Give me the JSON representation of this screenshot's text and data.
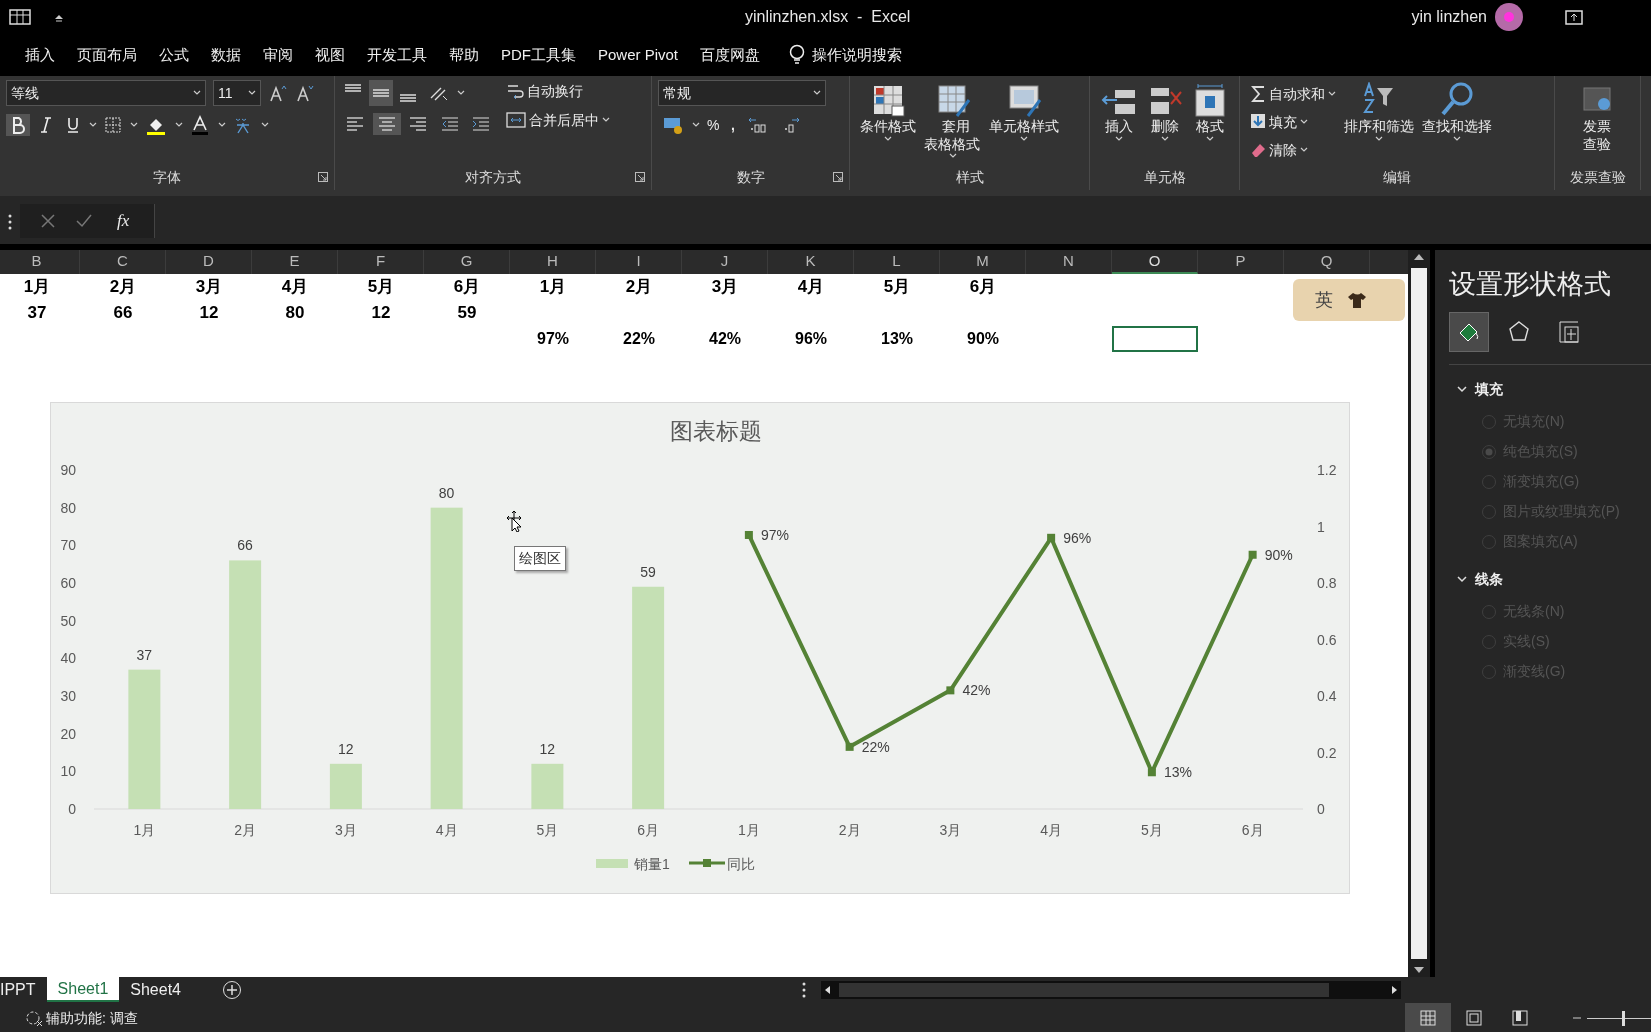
{
  "window": {
    "title": "yinlinzhen.xlsx  -  Excel",
    "user": "yin linzhen"
  },
  "menu_tabs": [
    "插入",
    "页面布局",
    "公式",
    "数据",
    "审阅",
    "视图",
    "开发工具",
    "帮助",
    "PDF工具集",
    "Power Pivot",
    "百度网盘"
  ],
  "tell_me": "操作说明搜索",
  "ribbon": {
    "font": {
      "group": "字体",
      "font_name": "等线",
      "font_size": "11",
      "bold": true,
      "italic": false,
      "underline": false
    },
    "alignment": {
      "group": "对齐方式",
      "vertical": [
        {
          "selected": false
        },
        {
          "selected": true
        },
        {
          "selected": false
        }
      ],
      "horizontal": [
        {
          "selected": false
        },
        {
          "selected": true
        },
        {
          "selected": false
        }
      ],
      "wrap": "自动换行",
      "merge": "合并后居中"
    },
    "number": {
      "group": "数字",
      "format": "常规",
      "percent": "%",
      "comma": ","
    },
    "styles": {
      "group": "样式",
      "buttons": [
        {
          "label": "条件格式",
          "kind": "conditional"
        },
        {
          "label": "套用表格格式",
          "kind": "table"
        },
        {
          "label": "单元格样式",
          "kind": "cellstyle"
        }
      ]
    },
    "cells": {
      "group": "单元格",
      "buttons": [
        {
          "label": "插入",
          "kind": "insert"
        },
        {
          "label": "删除",
          "kind": "delete"
        },
        {
          "label": "格式",
          "kind": "format"
        }
      ]
    },
    "editing": {
      "group": "编辑",
      "small": [
        {
          "label": "自动求和",
          "kind": "sum"
        },
        {
          "label": "填充",
          "kind": "fill"
        },
        {
          "label": "清除",
          "kind": "clear"
        }
      ],
      "buttons": [
        {
          "label": "排序和筛选",
          "kind": "sort"
        },
        {
          "label": "查找和选择",
          "kind": "find"
        }
      ]
    },
    "invoice": {
      "group": "发票查验",
      "button": "发票查验"
    }
  },
  "formula_bar": {
    "fx": "fx"
  },
  "columns": [
    {
      "label": "B",
      "selected": false
    },
    {
      "label": "C",
      "selected": false
    },
    {
      "label": "D",
      "selected": false
    },
    {
      "label": "E",
      "selected": false
    },
    {
      "label": "F",
      "selected": false
    },
    {
      "label": "G",
      "selected": false
    },
    {
      "label": "H",
      "selected": false
    },
    {
      "label": "I",
      "selected": false
    },
    {
      "label": "J",
      "selected": false
    },
    {
      "label": "K",
      "selected": false
    },
    {
      "label": "L",
      "selected": false
    },
    {
      "label": "M",
      "selected": false
    },
    {
      "label": "N",
      "selected": false
    },
    {
      "label": "O",
      "selected": true
    },
    {
      "label": "P",
      "selected": false
    },
    {
      "label": "Q",
      "selected": false
    }
  ],
  "rows": [
    {
      "selected": false,
      "cells": [
        "1月",
        "2月",
        "3月",
        "4月",
        "5月",
        "6月",
        "1月",
        "2月",
        "3月",
        "4月",
        "5月",
        "6月",
        null,
        null,
        null,
        null
      ]
    },
    {
      "selected": false,
      "cells": [
        "37",
        "66",
        "12",
        "80",
        "12",
        "59",
        null,
        null,
        null,
        null,
        null,
        null,
        null,
        null,
        null,
        null
      ]
    },
    {
      "selected": true,
      "cells": [
        null,
        null,
        null,
        null,
        null,
        null,
        "97%",
        "22%",
        "42%",
        "96%",
        "13%",
        "90%",
        null,
        null,
        null,
        null
      ]
    }
  ],
  "ime": {
    "label": "英"
  },
  "chart": {
    "tooltip": "绘图区",
    "chart_data": {
      "type": "bar",
      "title": "图表标题",
      "categories": [
        "1月",
        "2月",
        "3月",
        "4月",
        "5月",
        "6月",
        "1月",
        "2月",
        "3月",
        "4月",
        "5月",
        "6月"
      ],
      "series": [
        {
          "name": "销量1",
          "color": "#c5e0b4",
          "values": [
            37,
            66,
            12,
            80,
            12,
            59,
            null,
            null,
            null,
            null,
            null,
            null
          ],
          "value_labels": [
            "37",
            "66",
            "12",
            "80",
            "12",
            "59",
            null,
            null,
            null,
            null,
            null,
            null
          ]
        }
      ],
      "ylim": [
        0,
        90
      ],
      "yticks": [
        0,
        10,
        20,
        30,
        40,
        50,
        60,
        70,
        80,
        90
      ],
      "data_labels": true
    },
    "secondary": {
      "chart_data": {
        "type": "line",
        "series": [
          {
            "name": "同比",
            "color": "#548235",
            "marker": "square",
            "values": [
              null,
              null,
              null,
              null,
              null,
              null,
              0.97,
              0.22,
              0.42,
              0.96,
              0.13,
              0.9
            ],
            "value_labels": [
              null,
              null,
              null,
              null,
              null,
              null,
              "97%",
              "22%",
              "42%",
              "96%",
              "13%",
              "90%"
            ]
          }
        ],
        "ylim": [
          0,
          1.2
        ],
        "yticks": [
          0,
          0.2,
          0.4,
          0.6,
          0.8,
          1,
          1.2
        ],
        "data_labels": true
      }
    }
  },
  "pane": {
    "title": "设置形状格式",
    "tabs": [
      {
        "kind": "fill",
        "selected": true
      },
      {
        "kind": "effects",
        "selected": false
      },
      {
        "kind": "size",
        "selected": false
      }
    ],
    "sections": [
      {
        "title": "填充",
        "expanded": true,
        "options": [
          {
            "label": "无填充(N)",
            "selected": false,
            "disabled": true
          },
          {
            "label": "纯色填充(S)",
            "selected": true,
            "disabled": true
          },
          {
            "label": "渐变填充(G)",
            "selected": false,
            "disabled": true
          },
          {
            "label": "图片或纹理填充(P)",
            "selected": false,
            "disabled": true
          },
          {
            "label": "图案填充(A)",
            "selected": false,
            "disabled": true
          }
        ]
      },
      {
        "title": "线条",
        "expanded": true,
        "options": [
          {
            "label": "无线条(N)",
            "selected": false,
            "disabled": true
          },
          {
            "label": "实线(S)",
            "selected": false,
            "disabled": true
          },
          {
            "label": "渐变线(G)",
            "selected": false,
            "disabled": true
          }
        ]
      }
    ]
  },
  "sheet_tabs": [
    {
      "label": "IPPT",
      "selected": false
    },
    {
      "label": "Sheet1",
      "selected": true
    },
    {
      "label": "Sheet4",
      "selected": false
    }
  ],
  "status_bar": {
    "accessibility": "辅助功能: 调查",
    "views": [
      {
        "kind": "normal",
        "selected": true
      },
      {
        "kind": "layout",
        "selected": false
      },
      {
        "kind": "pagebreak",
        "selected": false
      }
    ],
    "zoom": {
      "level": 0.55
    }
  }
}
